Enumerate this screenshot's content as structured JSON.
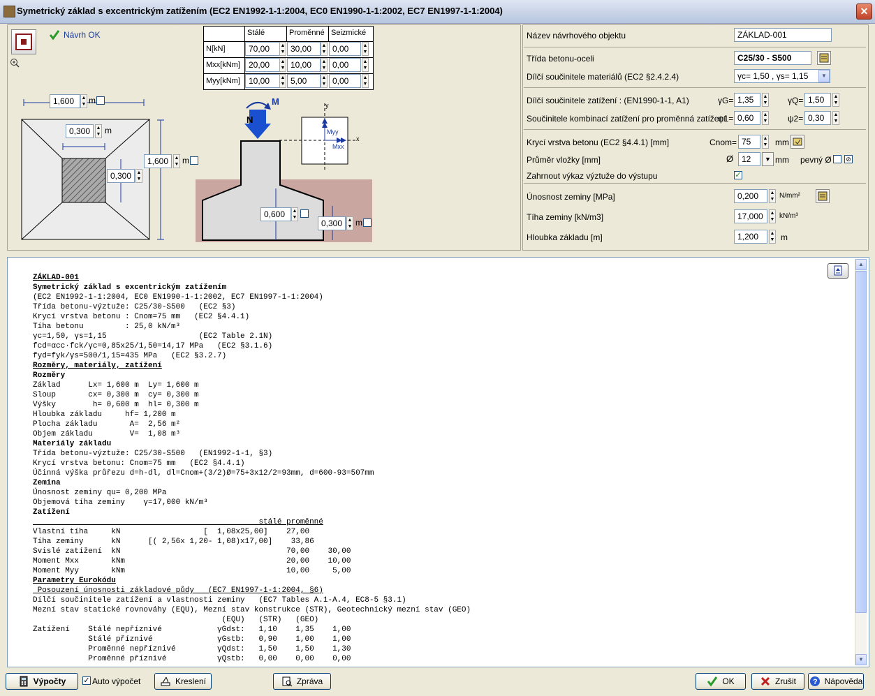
{
  "window": {
    "title": "Symetrický základ s excentrickým zatížením (EC2 EN1992-1-1:2004, EC0 EN1990-1-1:2002, EC7 EN1997-1-1:2004)",
    "close": "✕"
  },
  "status": {
    "label": "Návrh OK"
  },
  "load_table": {
    "columns": [
      "Stálé",
      "Proměnné",
      "Seizmické"
    ],
    "rows": [
      {
        "label": "N[kN]",
        "values": [
          "70,00",
          "30,00",
          "0,00"
        ]
      },
      {
        "label": "Mxx[kNm]",
        "values": [
          "20,00",
          "10,00",
          "0,00"
        ]
      },
      {
        "label": "Myy[kNm]",
        "values": [
          "10,00",
          "5,00",
          "0,00"
        ]
      }
    ]
  },
  "drawing": {
    "Lx": "1,600",
    "Ly": "1,600",
    "cx": "0,300",
    "cy": "0,300",
    "h": "0,600",
    "hl": "0,300",
    "unit": "m",
    "label_M": "M",
    "label_N": "N",
    "axis_y": "y",
    "axis_x": "x",
    "label_Myy": "Myy",
    "label_Mxx": "Mxx"
  },
  "params": {
    "name_label": "Název návrhového objektu",
    "name_value": "ZÁKLAD-001",
    "class_label": "Třída betonu-oceli",
    "class_value": "C25/30 - S500",
    "mat_factors_label": "Dílčí součinitele materiálů (EC2 §2.4.2.4)",
    "mat_factors_value": "γc= 1,50 , γs= 1,15",
    "load_factors_label": "Dílčí součinitele zatížení    : (EN1990-1-1, A1)",
    "gG_label": "γG=",
    "gG_value": "1,35",
    "gQ_label": "γQ=",
    "gQ_value": "1,50",
    "comb_label": "Součinitele kombinací zatížení pro proměnná zatížení",
    "psi1_label": "ψ1=",
    "psi1_value": "0,60",
    "psi2_label": "ψ2=",
    "psi2_value": "0,30",
    "cover_label": "Krycí vrstva betonu (EC2 §4.4.1) [mm]",
    "cnom_label": "Cnom=",
    "cnom_value": "75",
    "mm": "mm",
    "bar_label": "Průměr vložky [mm]",
    "bar_symbol": "Ø",
    "bar_value": "12",
    "fixed_label": "pevný Ø",
    "include_label": "Zahrnout výkaz výztuže do výstupu",
    "soil_cap_label": "Únosnost zeminy [MPa]",
    "soil_cap_value": "0,200",
    "soil_cap_unit": "N/mm²",
    "soil_w_label": "Tíha zeminy [kN/m3]",
    "soil_w_value": "17,000",
    "soil_w_unit": "kN/m³",
    "depth_label": "Hloubka základu [m]",
    "depth_value": "1,200",
    "depth_unit": "m"
  },
  "report": {
    "lines": [
      "ZÁKLAD-001",
      "Symetrický základ s excentrickým zatížením",
      "(EC2 EN1992-1-1:2004, EC0 EN1990-1-1:2002, EC7 EN1997-1-1:2004)",
      "Třída betonu-výztuže: C25/30-S500   (EC2 §3)",
      "Krycí vrstva betonu : Cnom=75 mm   (EC2 §4.4.1)",
      "Tíha betonu         : 25,0 kN/m³",
      "γc=1,50, γs=1,15                    (EC2 Table 2.1N)",
      "fcd=αcc·fck/γc=0,85x25/1,50=14,17 MPa   (EC2 §3.1.6)",
      "fyd=fyk/γs=500/1,15=435 MPa   (EC2 §3.2.7)",
      "Rozměry, materiály, zatížení",
      "Rozměry",
      "Základ      Lx= 1,600 m  Ly= 1,600 m",
      "Sloup       cx= 0,300 m  cy= 0,300 m",
      "Výšky        h= 0,600 m  hl= 0,300 m",
      "Hloubka základu     hf= 1,200 m",
      "Plocha základu       A=  2,56 m²",
      "Objem základu        V=  1,08 m³",
      "Materiály základu",
      "Třída betonu-výztuže: C25/30-S500   (EN1992-1-1, §3)",
      "Krycí vrstva betonu: Cnom=75 mm   (EC2 §4.4.1)",
      "Účinná výška průřezu d=h-dl, dl=Cnom+(3/2)Ø=75+3x12/2=93mm, d=600-93=507mm",
      "Zemina",
      "Únosnost zeminy qu= 0,200 MPa",
      "Objemová tíha zeminy    γ=17,000 kN/m³",
      "Zatížení",
      "                                                 stálé proměnné",
      "Vlastní tíha     kN                  [  1,08x25,00]    27,00",
      "Tíha zeminy      kN      [( 2,56x 1,20- 1,08)x17,00]    33,86",
      "Svislé zatížení  kN                                    70,00    30,00",
      "Moment Mxx       kNm                                   20,00    10,00",
      "Moment Myy       kNm                                   10,00     5,00",
      "Parametry Eurokódu",
      " Posouzení únosnosti základové půdy   (EC7 EN1997-1-1:2004, §6)",
      "Dílčí součinitele zatížení a vlastnosti zeminy   (EC7 Tables A.1-A.4, EC8-5 §3.1)",
      "Mezní stav statické rovnováhy (EQU), Mezní stav konstrukce (STR), Geotechnický mezní stav (GEO)",
      "                                         (EQU)   (STR)   (GEO)",
      "Zatížení    Stálé nepříznivé            γGdst:   1,10    1,35    1,00",
      "            Stálé příznivé              γGstb:   0,90    1,00    1,00",
      "            Proměnné nepříznivé         γQdst:   1,50    1,50    1,30",
      "            Proměnné příznivé           γQstb:   0,00    0,00    0,00"
    ]
  },
  "bottom": {
    "calc": "Výpočty",
    "auto": "Auto výpočet",
    "draw": "Kreslení",
    "report": "Zpráva",
    "ok": "OK",
    "cancel": "Zrušit",
    "help": "Nápověda"
  }
}
